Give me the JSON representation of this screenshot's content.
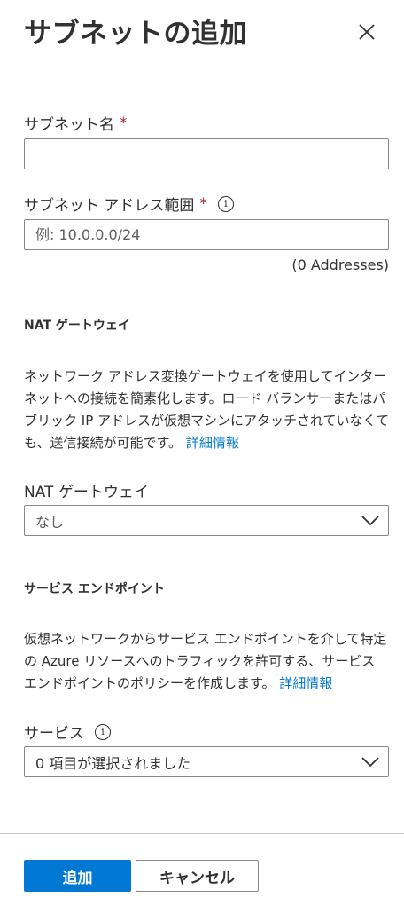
{
  "header": {
    "title": "サブネットの追加",
    "close_icon": "close-icon"
  },
  "subnet_name": {
    "label": "サブネット名",
    "required_mark": "*",
    "value": ""
  },
  "address_range": {
    "label": "サブネット アドレス範囲",
    "required_mark": "*",
    "info_icon": "ⓘ",
    "placeholder": "例: 10.0.0.0/24",
    "address_count": "(0 Addresses)"
  },
  "nat_gateway": {
    "section_title": "NAT ゲートウェイ",
    "description": "ネットワーク アドレス変換ゲートウェイを使用してインターネットへの接続を簡素化します。ロード バランサーまたはパブリック IP アドレスが仮想マシンにアタッチされていなくても、送信接続が可能です。",
    "link": "詳細情報",
    "field_label": "NAT ゲートウェイ",
    "selected": "なし"
  },
  "service_endpoints": {
    "section_title": "サービス エンドポイント",
    "description": "仮想ネットワークからサービス エンドポイントを介して特定の Azure リソースへのトラフィックを許可する、サービス エンドポイントのポリシーを作成します。",
    "link": "詳細情報",
    "field_label": "サービス",
    "info_icon": "ⓘ",
    "selected": "0 項目が選択されました"
  },
  "footer": {
    "add_button": "追加",
    "cancel_button": "キャンセル"
  },
  "colors": {
    "primary": "#0078d4",
    "required": "#a4262c",
    "text": "#323130",
    "border": "#8a8886"
  }
}
